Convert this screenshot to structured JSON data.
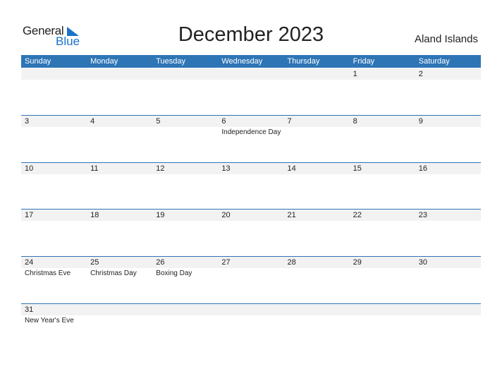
{
  "logo": {
    "part1": "General",
    "part2": "Blue",
    "brand_color": "#1a73c8"
  },
  "title": "December 2023",
  "country": "Aland Islands",
  "header_color": "#2e75b6",
  "weekdays": [
    "Sunday",
    "Monday",
    "Tuesday",
    "Wednesday",
    "Thursday",
    "Friday",
    "Saturday"
  ],
  "weeks": [
    {
      "days": [
        "",
        "",
        "",
        "",
        "",
        "1",
        "2"
      ],
      "holidays": [
        "",
        "",
        "",
        "",
        "",
        "",
        ""
      ]
    },
    {
      "days": [
        "3",
        "4",
        "5",
        "6",
        "7",
        "8",
        "9"
      ],
      "holidays": [
        "",
        "",
        "",
        "Independence Day",
        "",
        "",
        ""
      ]
    },
    {
      "days": [
        "10",
        "11",
        "12",
        "13",
        "14",
        "15",
        "16"
      ],
      "holidays": [
        "",
        "",
        "",
        "",
        "",
        "",
        ""
      ]
    },
    {
      "days": [
        "17",
        "18",
        "19",
        "20",
        "21",
        "22",
        "23"
      ],
      "holidays": [
        "",
        "",
        "",
        "",
        "",
        "",
        ""
      ]
    },
    {
      "days": [
        "24",
        "25",
        "26",
        "27",
        "28",
        "29",
        "30"
      ],
      "holidays": [
        "Christmas Eve",
        "Christmas Day",
        "Boxing Day",
        "",
        "",
        "",
        ""
      ]
    },
    {
      "days": [
        "31",
        "",
        "",
        "",
        "",
        "",
        ""
      ],
      "holidays": [
        "New Year's Eve",
        "",
        "",
        "",
        "",
        "",
        ""
      ]
    }
  ]
}
